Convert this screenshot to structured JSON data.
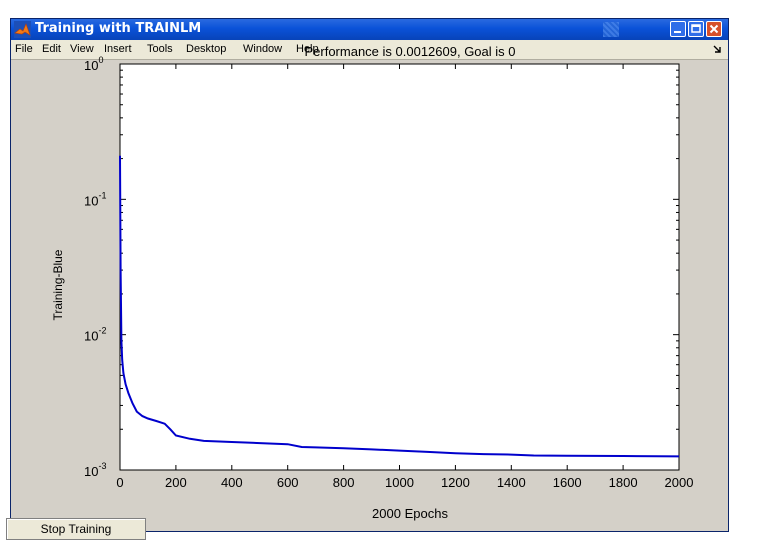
{
  "window": {
    "title": "Training with TRAINLM",
    "accent": "#0a52d8"
  },
  "menu": [
    "File",
    "Edit",
    "View",
    "Insert",
    "Tools",
    "Desktop",
    "Window",
    "Help"
  ],
  "buttons": {
    "stop_training": "Stop Training"
  },
  "chart_data": {
    "type": "line",
    "title": "Performance is 0.0012609, Goal is 0",
    "xlabel": "2000 Epochs",
    "ylabel": "Training-Blue",
    "xlim": [
      0,
      2000
    ],
    "ylim": [
      0.001,
      1
    ],
    "yscale": "log",
    "grid": false,
    "x_ticks": [
      "0",
      "200",
      "400",
      "600",
      "800",
      "1000",
      "1200",
      "1400",
      "1600",
      "1800",
      "2000"
    ],
    "y_ticks": [
      {
        "base": "10",
        "exp": "0"
      },
      {
        "base": "10",
        "exp": "-1"
      },
      {
        "base": "10",
        "exp": "-2"
      },
      {
        "base": "10",
        "exp": "-3"
      }
    ],
    "series": [
      {
        "color": "#0000cc",
        "x": [
          0,
          2,
          5,
          8,
          12,
          20,
          30,
          45,
          60,
          80,
          100,
          130,
          160,
          180,
          200,
          250,
          300,
          400,
          500,
          600,
          650,
          700,
          800,
          900,
          1000,
          1100,
          1200,
          1300,
          1400,
          1480,
          1600,
          1800,
          2000
        ],
        "y": [
          0.21,
          0.03,
          0.009,
          0.0065,
          0.0052,
          0.0043,
          0.0037,
          0.0031,
          0.0027,
          0.0025,
          0.0024,
          0.0023,
          0.0022,
          0.002,
          0.0018,
          0.0017,
          0.00164,
          0.00161,
          0.00158,
          0.00155,
          0.00148,
          0.00147,
          0.00145,
          0.00142,
          0.00139,
          0.00136,
          0.00133,
          0.00131,
          0.0013,
          0.00128,
          0.001275,
          0.00127,
          0.0012609
        ]
      }
    ]
  }
}
